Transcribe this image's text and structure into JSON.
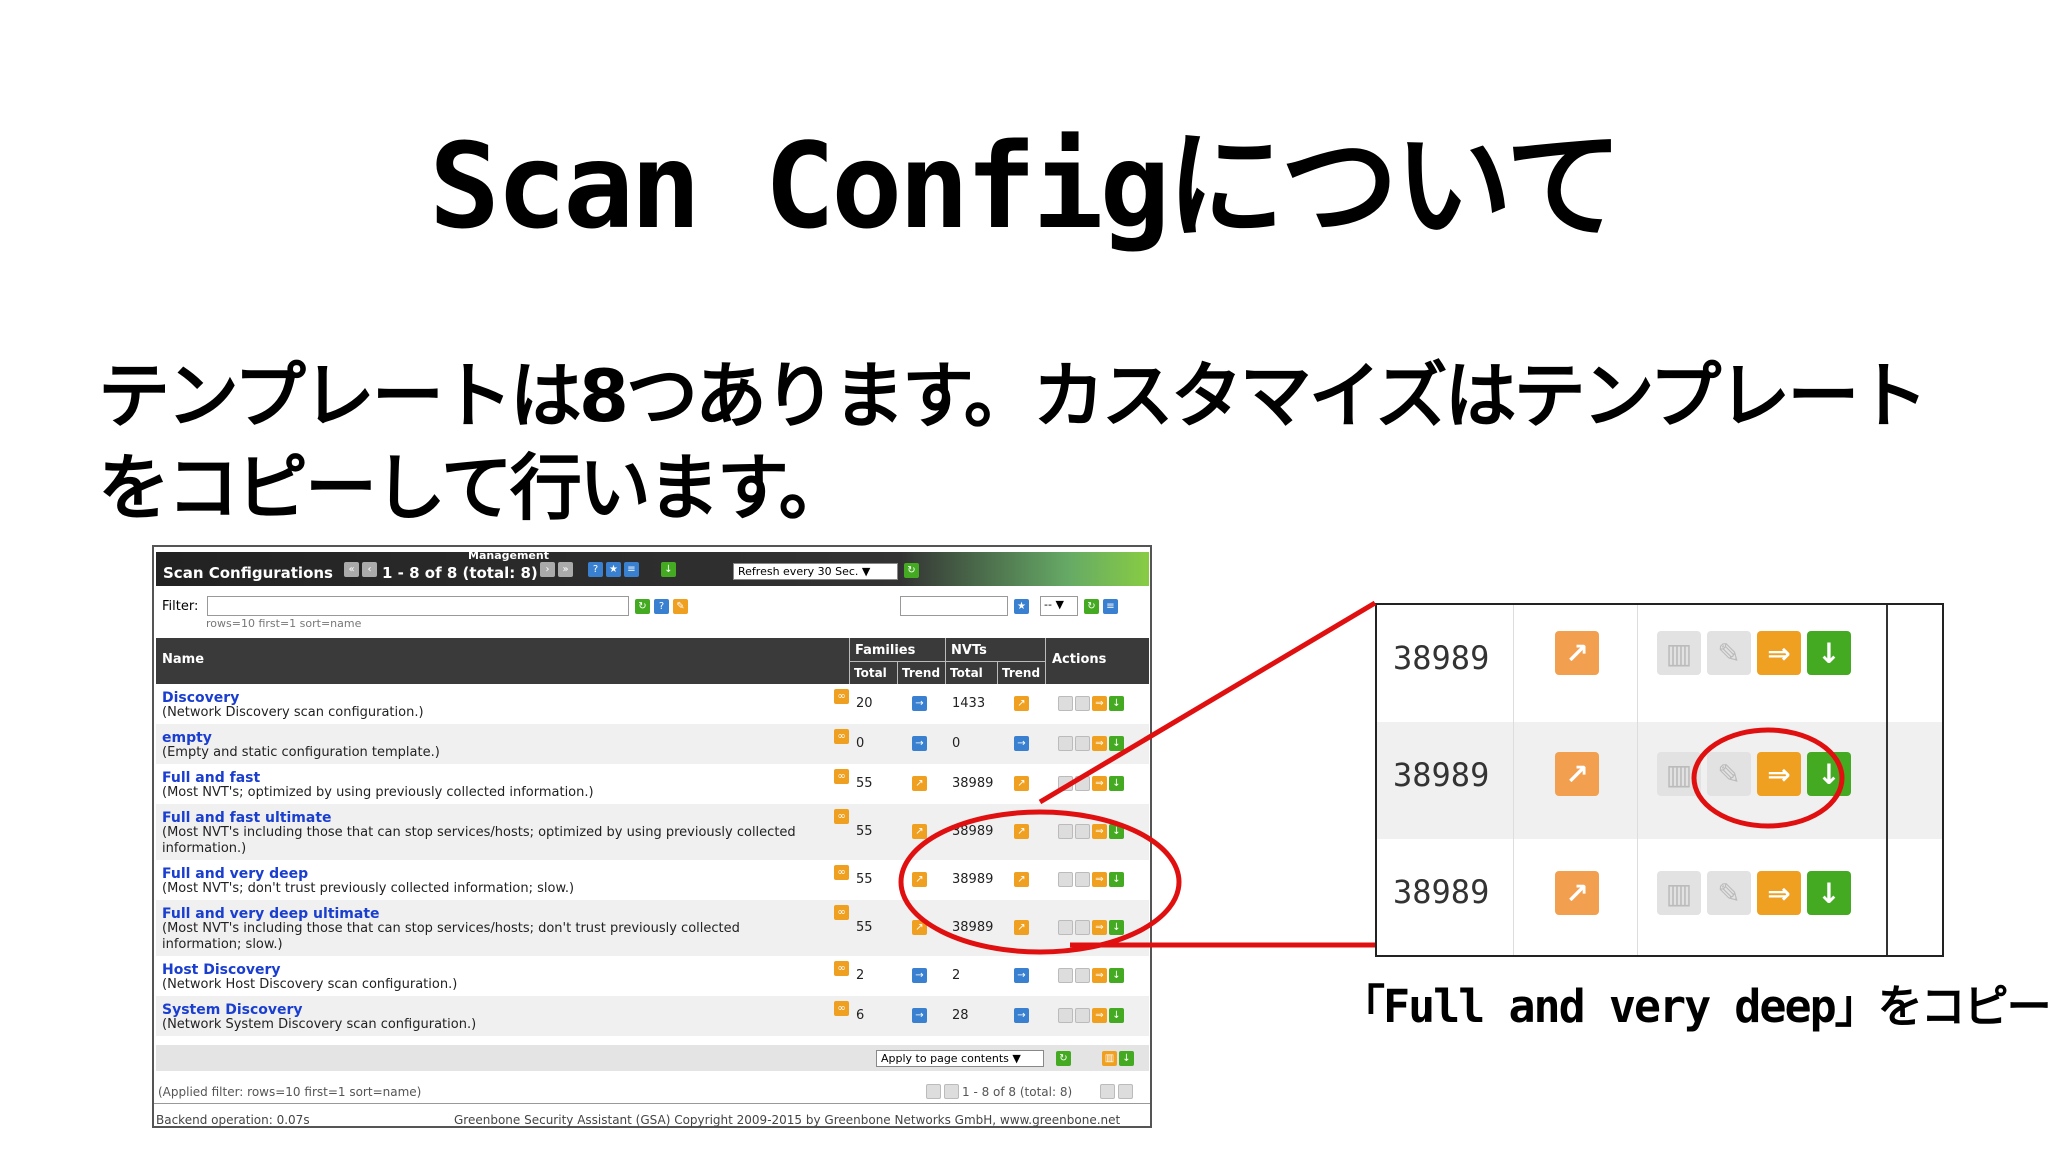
{
  "slide": {
    "title": "Scan Configについて",
    "subtitle_line1": "テンプレートは8つあります。カスタマイズはテンプレート",
    "subtitle_line2": "をコピーして行います。",
    "caption": "「Full and very deep」をコピー"
  },
  "gsa": {
    "management_label": "Management",
    "title": "Scan Configurations",
    "pager": "1 - 8 of 8 (total: 8)",
    "refresh_select": "Refresh every 30 Sec.",
    "filter_label": "Filter:",
    "filter_value": "",
    "filter_hint": "rows=10 first=1 sort=name",
    "filter_select": "--",
    "columns": {
      "name": "Name",
      "families": "Families",
      "nvts": "NVTs",
      "total": "Total",
      "trend": "Trend",
      "actions": "Actions"
    },
    "rows": [
      {
        "name": "Discovery",
        "desc": "(Network Discovery scan configuration.)",
        "families": "20",
        "nvts": "1433"
      },
      {
        "name": "empty",
        "desc": "(Empty and static configuration template.)",
        "families": "0",
        "nvts": "0"
      },
      {
        "name": "Full and fast",
        "desc": "(Most NVT's; optimized by using previously collected information.)",
        "families": "55",
        "nvts": "38989"
      },
      {
        "name": "Full and fast ultimate",
        "desc": "(Most NVT's including those that can stop services/hosts; optimized by using previously collected information.)",
        "families": "55",
        "nvts": "38989"
      },
      {
        "name": "Full and very deep",
        "desc": "(Most NVT's; don't trust previously collected information; slow.)",
        "families": "55",
        "nvts": "38989"
      },
      {
        "name": "Full and very deep ultimate",
        "desc": "(Most NVT's including those that can stop services/hosts; don't trust previously collected information; slow.)",
        "families": "55",
        "nvts": "38989"
      },
      {
        "name": "Host Discovery",
        "desc": "(Network Host Discovery scan configuration.)",
        "families": "2",
        "nvts": "2"
      },
      {
        "name": "System Discovery",
        "desc": "(Network System Discovery scan configuration.)",
        "families": "6",
        "nvts": "28"
      }
    ],
    "apply_select": "Apply to page contents",
    "applied_filter": "(Applied filter: rows=10 first=1 sort=name)",
    "bottom_pager": "1 - 8 of 8 (total: 8)",
    "backend": "Backend operation: 0.07s",
    "copyright": "Greenbone Security Assistant (GSA) Copyright 2009-2015 by Greenbone Networks GmbH, www.greenbone.net"
  },
  "zoom": {
    "rows": [
      {
        "nvts": "38989"
      },
      {
        "nvts": "38989"
      },
      {
        "nvts": "38989"
      }
    ]
  },
  "colors": {
    "highlight": "#e01010",
    "accent_green": "#44aa22",
    "accent_orange": "#f0a020",
    "link_blue": "#1a3ecf"
  },
  "icons": [
    "first-page-icon",
    "prev-page-icon",
    "next-page-icon",
    "last-page-icon",
    "help-icon",
    "new-icon",
    "list-icon",
    "upload-icon",
    "refresh-icon",
    "trashcan-icon",
    "edit-icon",
    "clone-icon",
    "export-icon",
    "trend-icon"
  ]
}
